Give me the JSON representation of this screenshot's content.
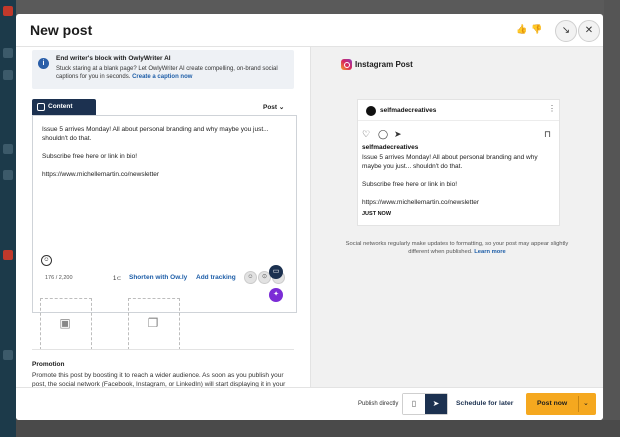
{
  "header": {
    "title": "New post",
    "thumbs_up": "👍",
    "thumbs_down": "👎",
    "minimize_glyph": "↘",
    "close_glyph": "✕"
  },
  "ai_banner": {
    "title": "End writer's block with OwlyWriter AI",
    "body": "Stuck staring at a blank page? Let OwlyWriter AI create compelling, on-brand social captions for you in seconds.",
    "link": "Create a caption now"
  },
  "composer": {
    "tab_label": "Content",
    "post_type": "Post",
    "text": "Issue 5 arrives Monday! All about personal branding and why maybe you just... shouldn't do that.\n\nSubscribe free here or link in bio!\n\nhttps://www.michellemartin.co/newsletter",
    "char_count": "176 / 2,200",
    "link_count": "1",
    "shorten_label": "Shorten with Ow.ly",
    "tracking_label": "Add tracking"
  },
  "promotion": {
    "title": "Promotion",
    "body": "Promote this post by boosting it to reach a wider audience. As soon as you publish your post, the social network (Facebook, Instagram, or LinkedIn) will start displaying it in your audience's timeline."
  },
  "preview": {
    "heading": "Instagram Post",
    "account": "selfmadecreatives",
    "caption_user": "selfmadecreatives",
    "caption": "Issue 5 arrives Monday! All about personal branding and why maybe you just... shouldn't do that.\n\nSubscribe free here or link in bio!\n\nhttps://www.michellemartin.co/newsletter",
    "time": "JUST NOW",
    "note": "Social networks regularly make updates to formatting, so your post may appear slightly different when published.",
    "note_link": "Learn more"
  },
  "footer": {
    "publish_directly": "Publish directly",
    "schedule_label": "Schedule for later",
    "post_now_label": "Post now"
  },
  "colors": {
    "accent": "#f5a81f",
    "navy": "#1c3150",
    "link": "#1e5ea8"
  }
}
